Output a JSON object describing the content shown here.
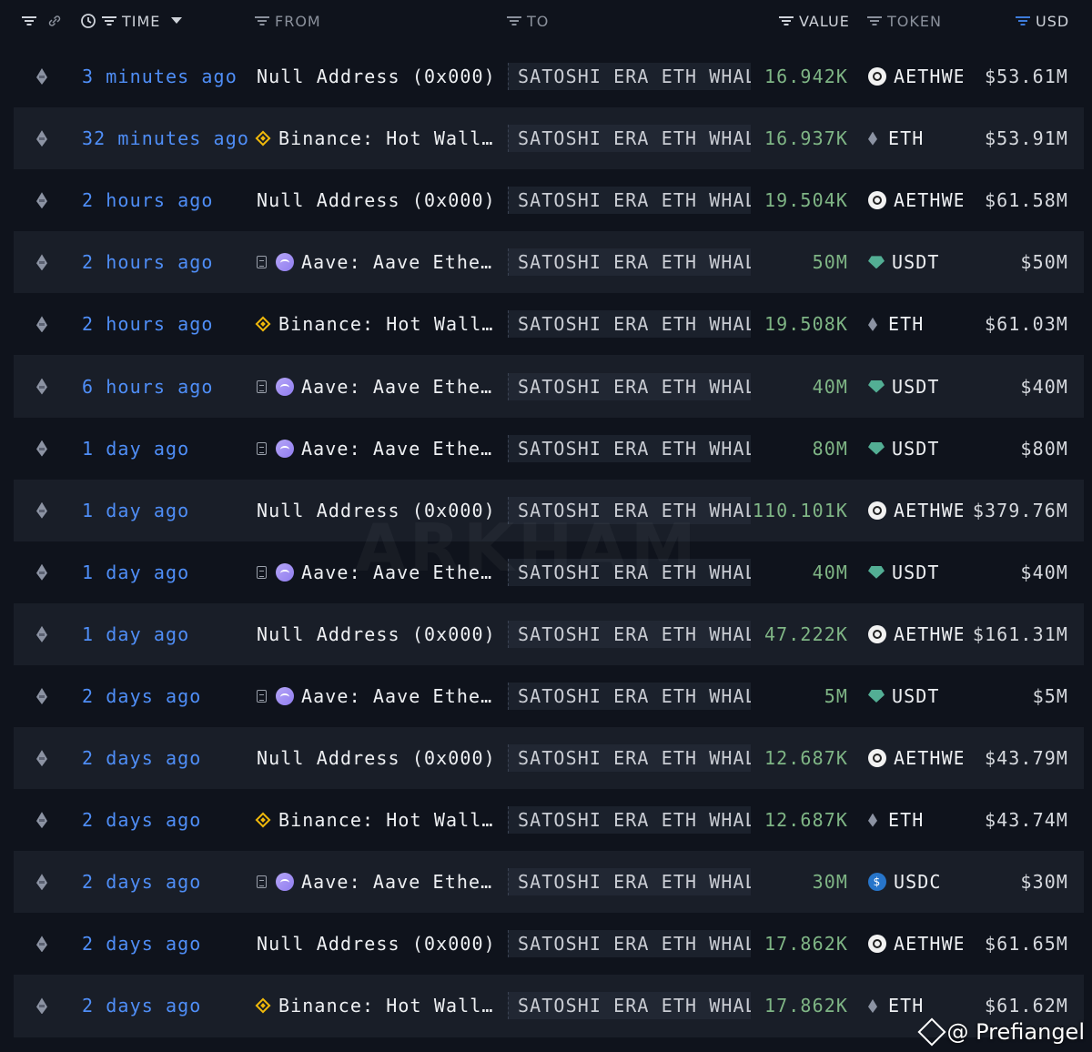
{
  "header": {
    "time_label": "TIME",
    "from_label": "FROM",
    "to_label": "TO",
    "value_label": "VALUE",
    "token_label": "TOKEN",
    "usd_label": "USD"
  },
  "rows": [
    {
      "time": "3 minutes ago",
      "from": "Null Address (0x000)",
      "from_icon": "none",
      "to": "SATOSHI ERA ETH WHALE",
      "value": "16.942K",
      "token": "AETHWETH",
      "token_icon": "aeth-icon",
      "usd": "$53.61M"
    },
    {
      "time": "32 minutes ago",
      "from": "Binance: Hot Wall…",
      "from_icon": "binance-icon",
      "to": "SATOSHI ERA ETH WHALE",
      "value": "16.937K",
      "token": "ETH",
      "token_icon": "eth-icon",
      "usd": "$53.91M"
    },
    {
      "time": "2 hours ago",
      "from": "Null Address (0x000)",
      "from_icon": "none",
      "to": "SATOSHI ERA ETH WHALE",
      "value": "19.504K",
      "token": "AETHWETH",
      "token_icon": "aeth-icon",
      "usd": "$61.58M"
    },
    {
      "time": "2 hours ago",
      "from": "Aave: Aave Ethe…",
      "from_icon": "aave-icon",
      "to": "SATOSHI ERA ETH WHALE",
      "value": "50M",
      "token": "USDT",
      "token_icon": "usdt-icon",
      "usd": "$50M"
    },
    {
      "time": "2 hours ago",
      "from": "Binance: Hot Wall…",
      "from_icon": "binance-icon",
      "to": "SATOSHI ERA ETH WHALE",
      "value": "19.508K",
      "token": "ETH",
      "token_icon": "eth-icon",
      "usd": "$61.03M"
    },
    {
      "time": "6 hours ago",
      "from": "Aave: Aave Ethe…",
      "from_icon": "aave-icon",
      "to": "SATOSHI ERA ETH WHALE",
      "value": "40M",
      "token": "USDT",
      "token_icon": "usdt-icon",
      "usd": "$40M"
    },
    {
      "time": "1 day ago",
      "from": "Aave: Aave Ethe…",
      "from_icon": "aave-icon",
      "to": "SATOSHI ERA ETH WHALE",
      "value": "80M",
      "token": "USDT",
      "token_icon": "usdt-icon",
      "usd": "$80M"
    },
    {
      "time": "1 day ago",
      "from": "Null Address (0x000)",
      "from_icon": "none",
      "to": "SATOSHI ERA ETH WHALE",
      "value": "110.101K",
      "token": "AETHWETH",
      "token_icon": "aeth-icon",
      "usd": "$379.76M"
    },
    {
      "time": "1 day ago",
      "from": "Aave: Aave Ethe…",
      "from_icon": "aave-icon",
      "to": "SATOSHI ERA ETH WHALE",
      "value": "40M",
      "token": "USDT",
      "token_icon": "usdt-icon",
      "usd": "$40M"
    },
    {
      "time": "1 day ago",
      "from": "Null Address (0x000)",
      "from_icon": "none",
      "to": "SATOSHI ERA ETH WHALE",
      "value": "47.222K",
      "token": "AETHWETH",
      "token_icon": "aeth-icon",
      "usd": "$161.31M"
    },
    {
      "time": "2 days ago",
      "from": "Aave: Aave Ethe…",
      "from_icon": "aave-icon",
      "to": "SATOSHI ERA ETH WHALE",
      "value": "5M",
      "token": "USDT",
      "token_icon": "usdt-icon",
      "usd": "$5M"
    },
    {
      "time": "2 days ago",
      "from": "Null Address (0x000)",
      "from_icon": "none",
      "to": "SATOSHI ERA ETH WHALE",
      "value": "12.687K",
      "token": "AETHWETH",
      "token_icon": "aeth-icon",
      "usd": "$43.79M"
    },
    {
      "time": "2 days ago",
      "from": "Binance: Hot Wall…",
      "from_icon": "binance-icon",
      "to": "SATOSHI ERA ETH WHALE",
      "value": "12.687K",
      "token": "ETH",
      "token_icon": "eth-icon",
      "usd": "$43.74M"
    },
    {
      "time": "2 days ago",
      "from": "Aave: Aave Ethe…",
      "from_icon": "aave-icon",
      "to": "SATOSHI ERA ETH WHALE",
      "value": "30M",
      "token": "USDC",
      "token_icon": "usdc-icon",
      "usd": "$30M"
    },
    {
      "time": "2 days ago",
      "from": "Null Address (0x000)",
      "from_icon": "none",
      "to": "SATOSHI ERA ETH WHALE",
      "value": "17.862K",
      "token": "AETHWETH",
      "token_icon": "aeth-icon",
      "usd": "$61.65M"
    },
    {
      "time": "2 days ago",
      "from": "Binance: Hot Wall…",
      "from_icon": "binance-icon",
      "to": "SATOSHI ERA ETH WHALE",
      "value": "17.862K",
      "token": "ETH",
      "token_icon": "eth-icon",
      "usd": "$61.62M"
    }
  ],
  "watermark": "ARKHAM",
  "credit": "@ Prefiangel",
  "colors": {
    "background": "#0f131c",
    "row_alt": "#191e28",
    "time_link": "#4f8ef7",
    "value_green": "#7fb585",
    "binance": "#f0b90b",
    "usdt": "#53ae94",
    "usdc": "#2775ca"
  }
}
